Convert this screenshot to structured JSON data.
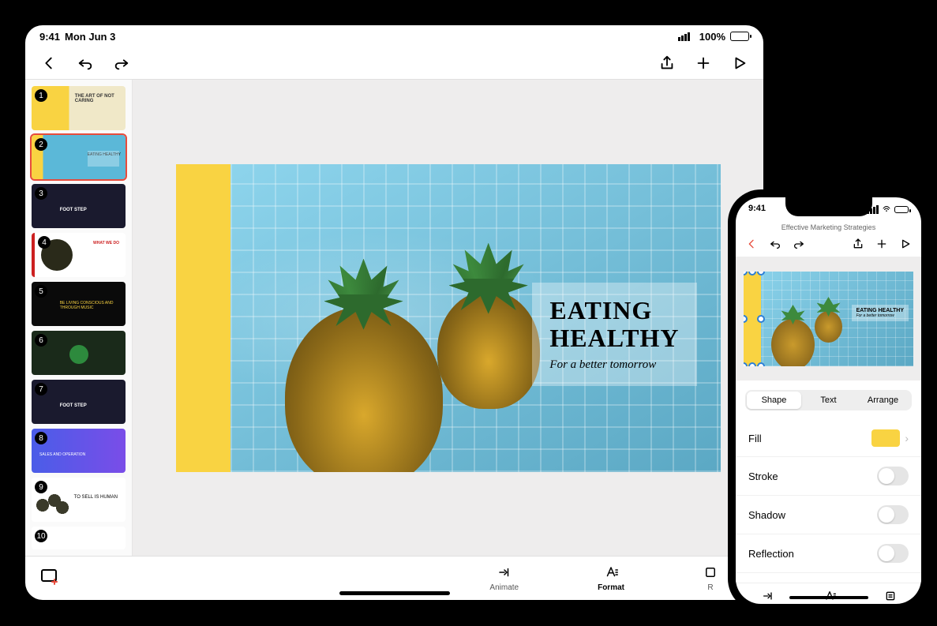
{
  "ipad": {
    "status": {
      "time": "9:41",
      "date": "Mon Jun 3",
      "battery": "100%"
    },
    "slides": [
      {
        "num": "1",
        "label": "THE ART OF NOT CARING"
      },
      {
        "num": "2",
        "label": "EATING HEALTHY"
      },
      {
        "num": "3",
        "label": "FOOT STEP"
      },
      {
        "num": "4",
        "label": "WHAT WE DO"
      },
      {
        "num": "5",
        "label": "BE LIVING CONSCIOUS AND THROUGH MUSIC"
      },
      {
        "num": "6",
        "label": ""
      },
      {
        "num": "7",
        "label": "FOOT STEP"
      },
      {
        "num": "8",
        "label": "SALES AND OPERATION"
      },
      {
        "num": "9",
        "label": "TO SELL IS HUMAN"
      },
      {
        "num": "10",
        "label": ""
      }
    ],
    "slide": {
      "title_line1": "EATING",
      "title_line2": "HEALTHY",
      "subtitle": "For a better tomorrow"
    },
    "bottom_tabs": {
      "animate": "Animate",
      "format": "Format",
      "review": "R"
    }
  },
  "iphone": {
    "status": {
      "time": "9:41"
    },
    "document_title": "Effective Marketing Strategies",
    "mini_slide": {
      "title": "EATING HEALTHY",
      "subtitle": "For a better tomorrow"
    },
    "segments": {
      "shape": "Shape",
      "text": "Text",
      "arrange": "Arrange"
    },
    "format_rows": {
      "fill": "Fill",
      "stroke": "Stroke",
      "shadow": "Shadow",
      "reflection": "Reflection"
    },
    "fill_color": "#f9d342",
    "bottom_tabs": {
      "animate": "Animate",
      "format": "Format",
      "review": "Review"
    }
  }
}
